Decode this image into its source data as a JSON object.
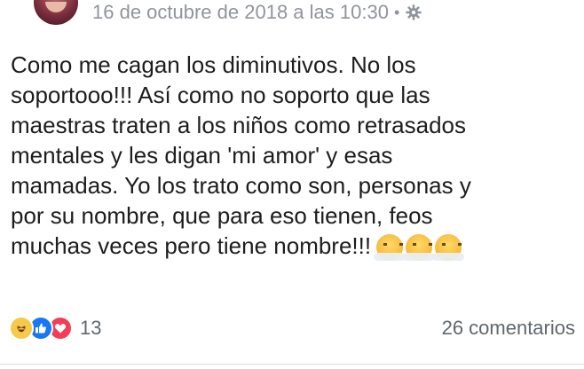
{
  "post": {
    "timestamp": "16 de octubre de 2018 a las 10:30",
    "separator": "•",
    "privacy_icon": "gear-icon",
    "text": "Como me cagan los diminutivos. No los\nsoportooo!!! Así como no soporto que las\nmaestras traten a los niños como retrasados\nmentales y les digan 'mi amor' y esas\nmamadas. Yo los trato como son, personas y\npor su nombre, que para eso tienen, feos\nmuchas veces pero tiene nombre!!!",
    "trailing_emojis": [
      "angry-steam-emoji",
      "angry-steam-emoji",
      "angry-steam-emoji"
    ]
  },
  "footer": {
    "reaction_icons": [
      "haha-icon",
      "like-icon",
      "love-icon"
    ],
    "reaction_count": "13",
    "comments_label": "26 comentarios"
  },
  "colors": {
    "meta_text": "#90949c",
    "like": "#1877f2",
    "love": "#f33e58",
    "haha": "#f7c948"
  }
}
